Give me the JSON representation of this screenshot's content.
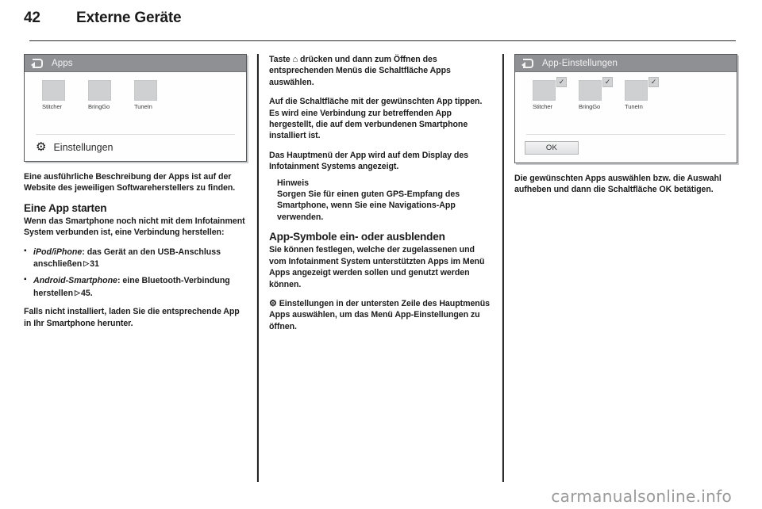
{
  "header": {
    "page_number": "42",
    "title": "Externe Geräte"
  },
  "footer": {
    "watermark": "carmanualsonline.info"
  },
  "figure_apps": {
    "title": "Apps",
    "back_icon": "back-arrow-icon",
    "apps": [
      {
        "label": "Stitcher",
        "checked": false
      },
      {
        "label": "BringGo",
        "checked": false
      },
      {
        "label": "TuneIn",
        "checked": false
      }
    ],
    "settings_row_label": "Einstellungen",
    "settings_icon": "gear-icon"
  },
  "figure_app_settings": {
    "title": "App-Einstellungen",
    "back_icon": "back-arrow-icon",
    "check_glyph": "✓",
    "apps": [
      {
        "label": "Stitcher",
        "checked": true
      },
      {
        "label": "BringGo",
        "checked": true
      },
      {
        "label": "TuneIn",
        "checked": true
      }
    ],
    "ok_label": "OK"
  },
  "column1": {
    "para1": "Eine ausführliche Beschreibung der Apps ist auf der Website des jeweiligen Softwareherstellers zu finden.",
    "heading1": "Eine App starten",
    "para2": "Wenn das Smartphone noch nicht mit dem Infotainment System verbunden ist, eine Verbindung herstellen:",
    "bullets": [
      {
        "lead": "iPod/iPhone",
        "text": ": das Gerät an den USB-Anschluss anschließen",
        "ref": "31"
      },
      {
        "lead": "Android-Smartphone",
        "text": ": eine Bluetooth-Verbindung herstellen",
        "ref": "45."
      }
    ],
    "para3": "Falls nicht installiert, laden Sie die entsprechende App in Ihr Smartphone herunter."
  },
  "column2": {
    "para1_before": "Taste ",
    "home_glyph": "⌂",
    "para1_after": " drücken und dann zum Öffnen des entsprechenden Menüs die Schaltfläche Apps auswählen.",
    "para2": "Auf die Schaltfläche mit der gewünschten App tippen. Es wird eine Verbindung zur betreffenden App hergestellt, die auf dem verbundenen Smartphone installiert ist.",
    "para3": "Das Hauptmenü der App wird auf dem Display des Infotainment Systems angezeigt.",
    "note_title": "Hinweis",
    "note_body": "Sorgen Sie für einen guten GPS-Empfang des Smartphone, wenn Sie eine Navigations-App verwenden.",
    "heading1": "App-Symbole ein- oder ausblenden",
    "para4": "Sie können festlegen, welche der zugelassenen und vom Infotainment System unterstützten Apps im Menü Apps angezeigt werden sollen und genutzt werden können.",
    "gear_glyph": "⚙",
    "para5": " Einstellungen in der untersten Zeile des Hauptmenüs Apps auswählen, um das Menü App-Einstellungen zu öffnen."
  },
  "column3": {
    "para1": "Die gewünschten Apps auswählen bzw. die Auswahl aufheben und dann die Schaltfläche OK betätigen."
  }
}
